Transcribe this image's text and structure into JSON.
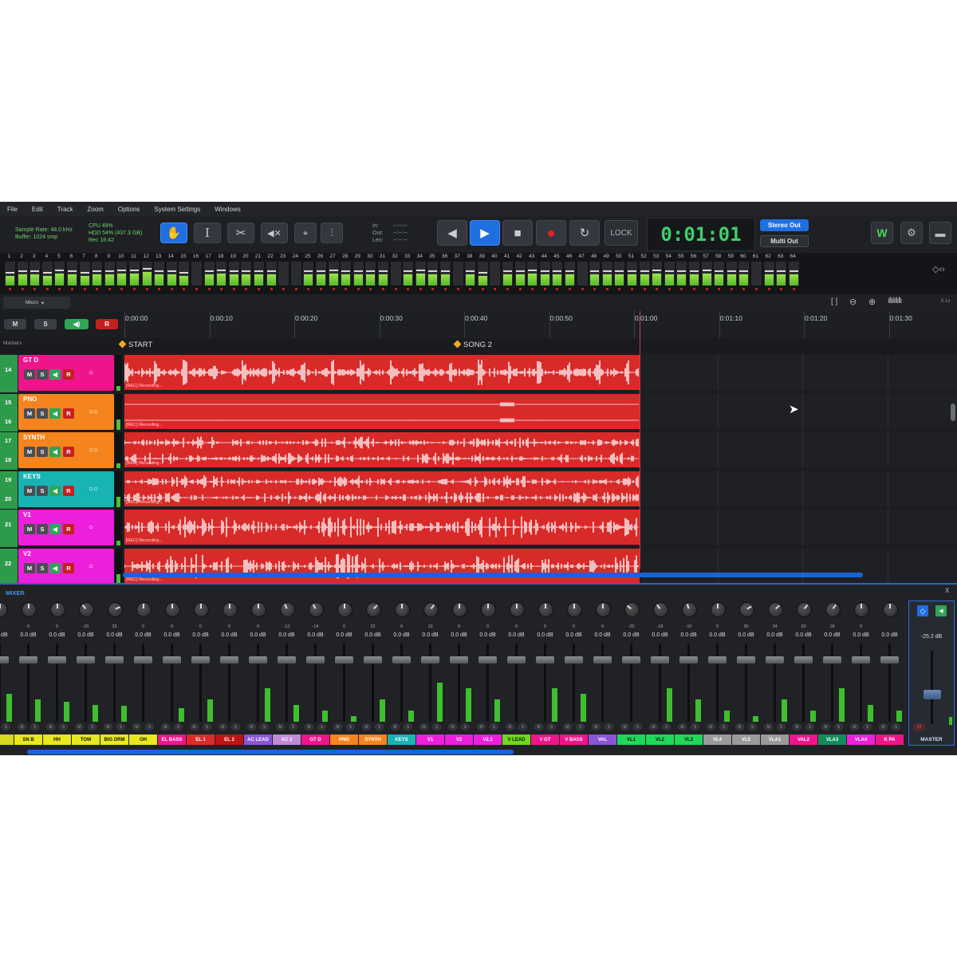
{
  "menu": [
    "File",
    "Edit",
    "Track",
    "Zoom",
    "Options",
    "System Settings",
    "Windows"
  ],
  "status": {
    "sample_rate": "Sample Rate: 48.0 kHz",
    "buffer": "Buffer: 1024 smp",
    "cpu": "CPU 49%",
    "hdd": "HDD 54% (437.3 GB)",
    "rec": "Rec 16:42"
  },
  "loop_info": {
    "in_label": "In:",
    "out_label": "Out:",
    "len_label": "Len:",
    "in_value": "--:--:--",
    "out_value": "--:--:--",
    "len_value": "--:--:--"
  },
  "transport": {
    "lock_label": "LOCK",
    "timecode": "0:01:01"
  },
  "outputs": {
    "stereo": "Stereo Out",
    "multi": "Multi Out"
  },
  "meter_levels": [
    0.4,
    0.45,
    0.45,
    0.4,
    0.5,
    0.45,
    0.4,
    0.45,
    0.45,
    0.5,
    0.5,
    0.55,
    0.45,
    0.45,
    0.4,
    0,
    0.45,
    0.5,
    0.45,
    0.45,
    0.45,
    0.45,
    0,
    0,
    0.45,
    0.45,
    0.5,
    0.45,
    0.45,
    0.45,
    0.45,
    0,
    0.45,
    0.5,
    0.45,
    0.45,
    0,
    0.45,
    0.4,
    0,
    0.45,
    0.45,
    0.5,
    0.45,
    0.45,
    0.45,
    0,
    0.45,
    0.45,
    0.45,
    0.45,
    0.45,
    0.5,
    0.45,
    0.45,
    0.45,
    0.5,
    0.45,
    0.45,
    0.45,
    0,
    0.45,
    0.45,
    0.45
  ],
  "view": {
    "micro_label": "Micro",
    "group_m": "M",
    "group_s": "S",
    "group_r": "R",
    "zoom_value": "5.1x"
  },
  "ruler": [
    "0:00:00",
    "0:00:10",
    "0:00:20",
    "0:00:30",
    "0:00:40",
    "0:00:50",
    "0:01:00",
    "0:01:10",
    "0:01:20",
    "0:01:30"
  ],
  "markers": {
    "row_label": "Markers",
    "items": [
      "START",
      "SONG 2"
    ]
  },
  "tracks": [
    {
      "nums": [
        "14"
      ],
      "name": "GT D",
      "color": "#f0148c",
      "mono": true
    },
    {
      "nums": [
        "15",
        "16"
      ],
      "name": "PNO",
      "color": "#f5841e",
      "mono": false
    },
    {
      "nums": [
        "17",
        "18"
      ],
      "name": "SYNTH",
      "color": "#f5841e",
      "mono": false
    },
    {
      "nums": [
        "19",
        "20"
      ],
      "name": "KEYS",
      "color": "#18b3b3",
      "mono": false
    },
    {
      "nums": [
        "21"
      ],
      "name": "V1",
      "color": "#ee1fdc",
      "mono": true
    },
    {
      "nums": [
        "22"
      ],
      "name": "V2",
      "color": "#ee1fdc",
      "mono": true
    }
  ],
  "track_buttons": {
    "m": "M",
    "s": "S",
    "r": "R"
  },
  "rec_label": "[REC] Recording...",
  "mixer": {
    "title": "MIXER",
    "close": "X",
    "pans": [
      "",
      "0",
      "0",
      "-20",
      "33",
      "0",
      "0",
      "0",
      "0",
      "0",
      "-12",
      "-14",
      "0",
      "22",
      "0",
      "19",
      "0",
      "0",
      "0",
      "0",
      "0",
      "0",
      "-25",
      "-18",
      "-10",
      "0",
      "30",
      "24",
      "20",
      "18",
      "0",
      ""
    ],
    "channels": [
      {
        "name": "",
        "color": "#d8d81c"
      },
      {
        "name": "SN B",
        "color": "#e8e81e"
      },
      {
        "name": "HH",
        "color": "#e8e81e"
      },
      {
        "name": "TOM",
        "color": "#e8e81e"
      },
      {
        "name": "BIG DRM",
        "color": "#e8e81e"
      },
      {
        "name": "OH",
        "color": "#e8e81e"
      },
      {
        "name": "EL BASS",
        "color": "#f0148c"
      },
      {
        "name": "EL 1",
        "color": "#e02a2a"
      },
      {
        "name": "EL 2",
        "color": "#c01414"
      },
      {
        "name": "AC LEAD",
        "color": "#8b55d8"
      },
      {
        "name": "AC 2",
        "color": "#c08ad8"
      },
      {
        "name": "GT D",
        "color": "#f0148c"
      },
      {
        "name": "PNO",
        "color": "#f5841e"
      },
      {
        "name": "SYNTH",
        "color": "#f5841e"
      },
      {
        "name": "KEYS",
        "color": "#18b3b3"
      },
      {
        "name": "V1",
        "color": "#ee1fdc"
      },
      {
        "name": "V2",
        "color": "#ee1fdc"
      },
      {
        "name": "V2.1",
        "color": "#ee1fdc"
      },
      {
        "name": "V LEAD",
        "color": "#6fd81e"
      },
      {
        "name": "V GT",
        "color": "#f0148c"
      },
      {
        "name": "V BASS",
        "color": "#f0148c"
      },
      {
        "name": "VAL",
        "color": "#8b55d8"
      },
      {
        "name": "VL1",
        "color": "#1fd85a"
      },
      {
        "name": "VL2",
        "color": "#1fd85a"
      },
      {
        "name": "VL3",
        "color": "#1fd85a"
      },
      {
        "name": "VL4",
        "color": "#9a9a9a"
      },
      {
        "name": "VL5",
        "color": "#9a9a9a"
      },
      {
        "name": "VLA1",
        "color": "#9a9a9a"
      },
      {
        "name": "VAL2",
        "color": "#f0148c"
      },
      {
        "name": "VLA3",
        "color": "#138a5a"
      },
      {
        "name": "VLA4",
        "color": "#ee1fdc"
      },
      {
        "name": "K PA",
        "color": "#f0148c"
      }
    ],
    "db_value": "0.0 dB",
    "meter_levels": [
      0.25,
      0.2,
      0.18,
      0.15,
      0.14,
      0,
      0.12,
      0.2,
      0,
      0.3,
      0.15,
      0.1,
      0.05,
      0.2,
      0.1,
      0.35,
      0.3,
      0.2,
      0,
      0.3,
      0.25,
      0,
      0,
      0.3,
      0.2,
      0.1,
      0.05,
      0.2,
      0.1,
      0.3,
      0.15,
      0.1
    ],
    "master": {
      "name": "MASTER",
      "db": "-25.2 dB",
      "m_label": "M"
    }
  }
}
